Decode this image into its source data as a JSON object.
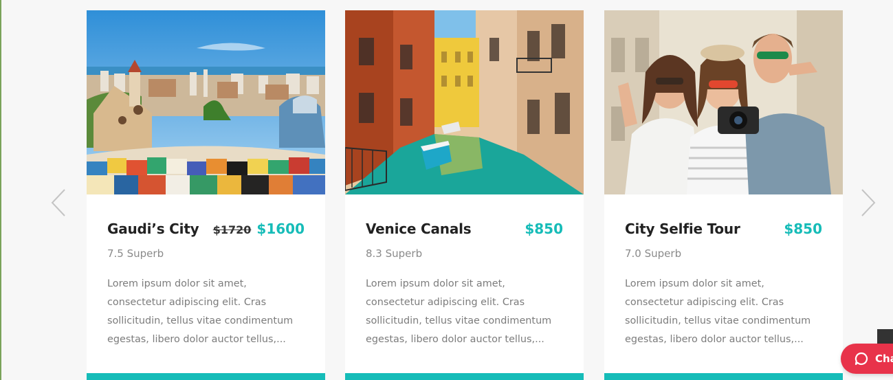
{
  "carousel": {
    "prev_icon": "chevron-left-icon",
    "next_icon": "chevron-right-icon",
    "accent_color": "#16bcb8",
    "cards": [
      {
        "title": "Gaudi’s City",
        "old_price": "$1720",
        "price": "$1600",
        "rating": "7.5 Superb",
        "description": "Lorem ipsum dolor sit amet, consectetur adipiscing elit. Cras sollicitudin, tellus vitae condimentum egestas, libero dolor auctor tellus,..."
      },
      {
        "title": "Venice Canals",
        "price": "$850",
        "rating": "8.3 Superb",
        "description": "Lorem ipsum dolor sit amet, consectetur adipiscing elit. Cras sollicitudin, tellus vitae condimentum egestas, libero dolor auctor tellus,..."
      },
      {
        "title": "City Selfie Tour",
        "price": "$850",
        "rating": "7.0 Superb",
        "description": "Lorem ipsum dolor sit amet, consectetur adipiscing elit. Cras sollicitudin, tellus vitae condimentum egestas, libero dolor auctor tellus,..."
      }
    ]
  },
  "chat": {
    "label": "Cha",
    "icon": "chat-bubble-icon",
    "color": "#e8334a"
  }
}
